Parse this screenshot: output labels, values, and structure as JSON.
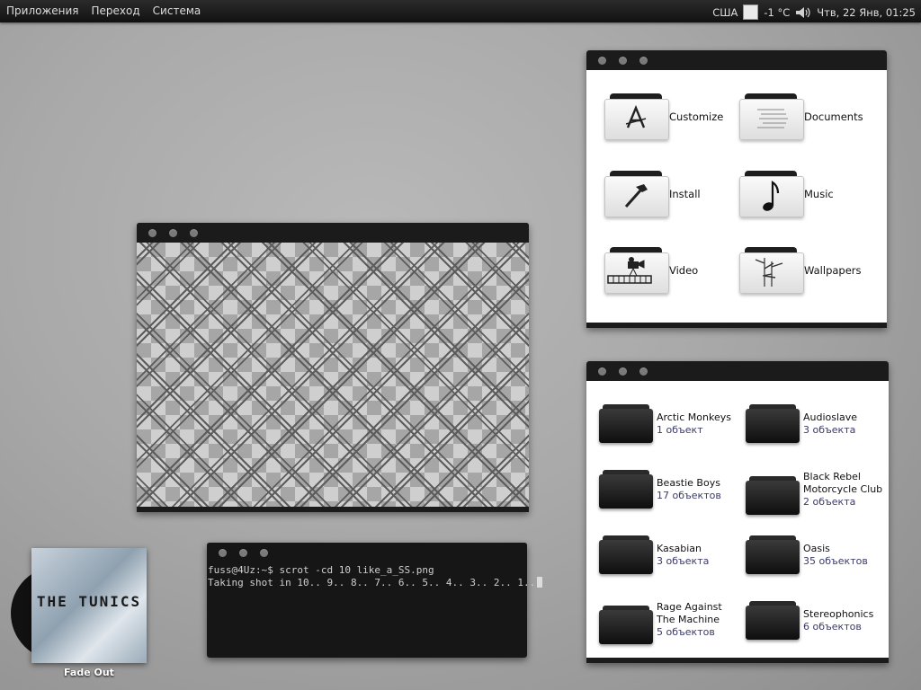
{
  "panel": {
    "menu": [
      "Приложения",
      "Переход",
      "Система"
    ],
    "keyboard_layout": "США",
    "weather": "-1 °C",
    "datetime": "Чтв, 22 Янв, 01:25"
  },
  "places": [
    {
      "label": "Customize",
      "icon": "app-store-icon"
    },
    {
      "label": "Documents",
      "icon": "document-icon"
    },
    {
      "label": "Install",
      "icon": "hammer-icon"
    },
    {
      "label": "Music",
      "icon": "music-note-icon"
    },
    {
      "label": "Video",
      "icon": "film-camera-icon"
    },
    {
      "label": "Wallpapers",
      "icon": "bamboo-icon"
    }
  ],
  "music_folders": [
    {
      "name": "Arctic Monkeys",
      "count": "1 объект"
    },
    {
      "name": "Audioslave",
      "count": "3 объекта"
    },
    {
      "name": "Beastie Boys",
      "count": "17 объектов"
    },
    {
      "name": "Black Rebel Motorcycle Club",
      "count": "2 объекта"
    },
    {
      "name": "Kasabian",
      "count": "3 объекта"
    },
    {
      "name": "Oasis",
      "count": "35 объектов"
    },
    {
      "name": "Rage Against The Machine",
      "count": "5 объектов"
    },
    {
      "name": "Stereophonics",
      "count": "6 объектов"
    }
  ],
  "terminal": {
    "line1": "fuss@4Uz:~$ scrot -cd 10 like_a_SS.png",
    "line2": "Taking shot in 10.. 9.. 8.. 7.. 6.. 5.. 4.. 3.. 2.. 1.."
  },
  "player": {
    "album_art_text": "THE TUNICS",
    "track": "Fade Out"
  }
}
